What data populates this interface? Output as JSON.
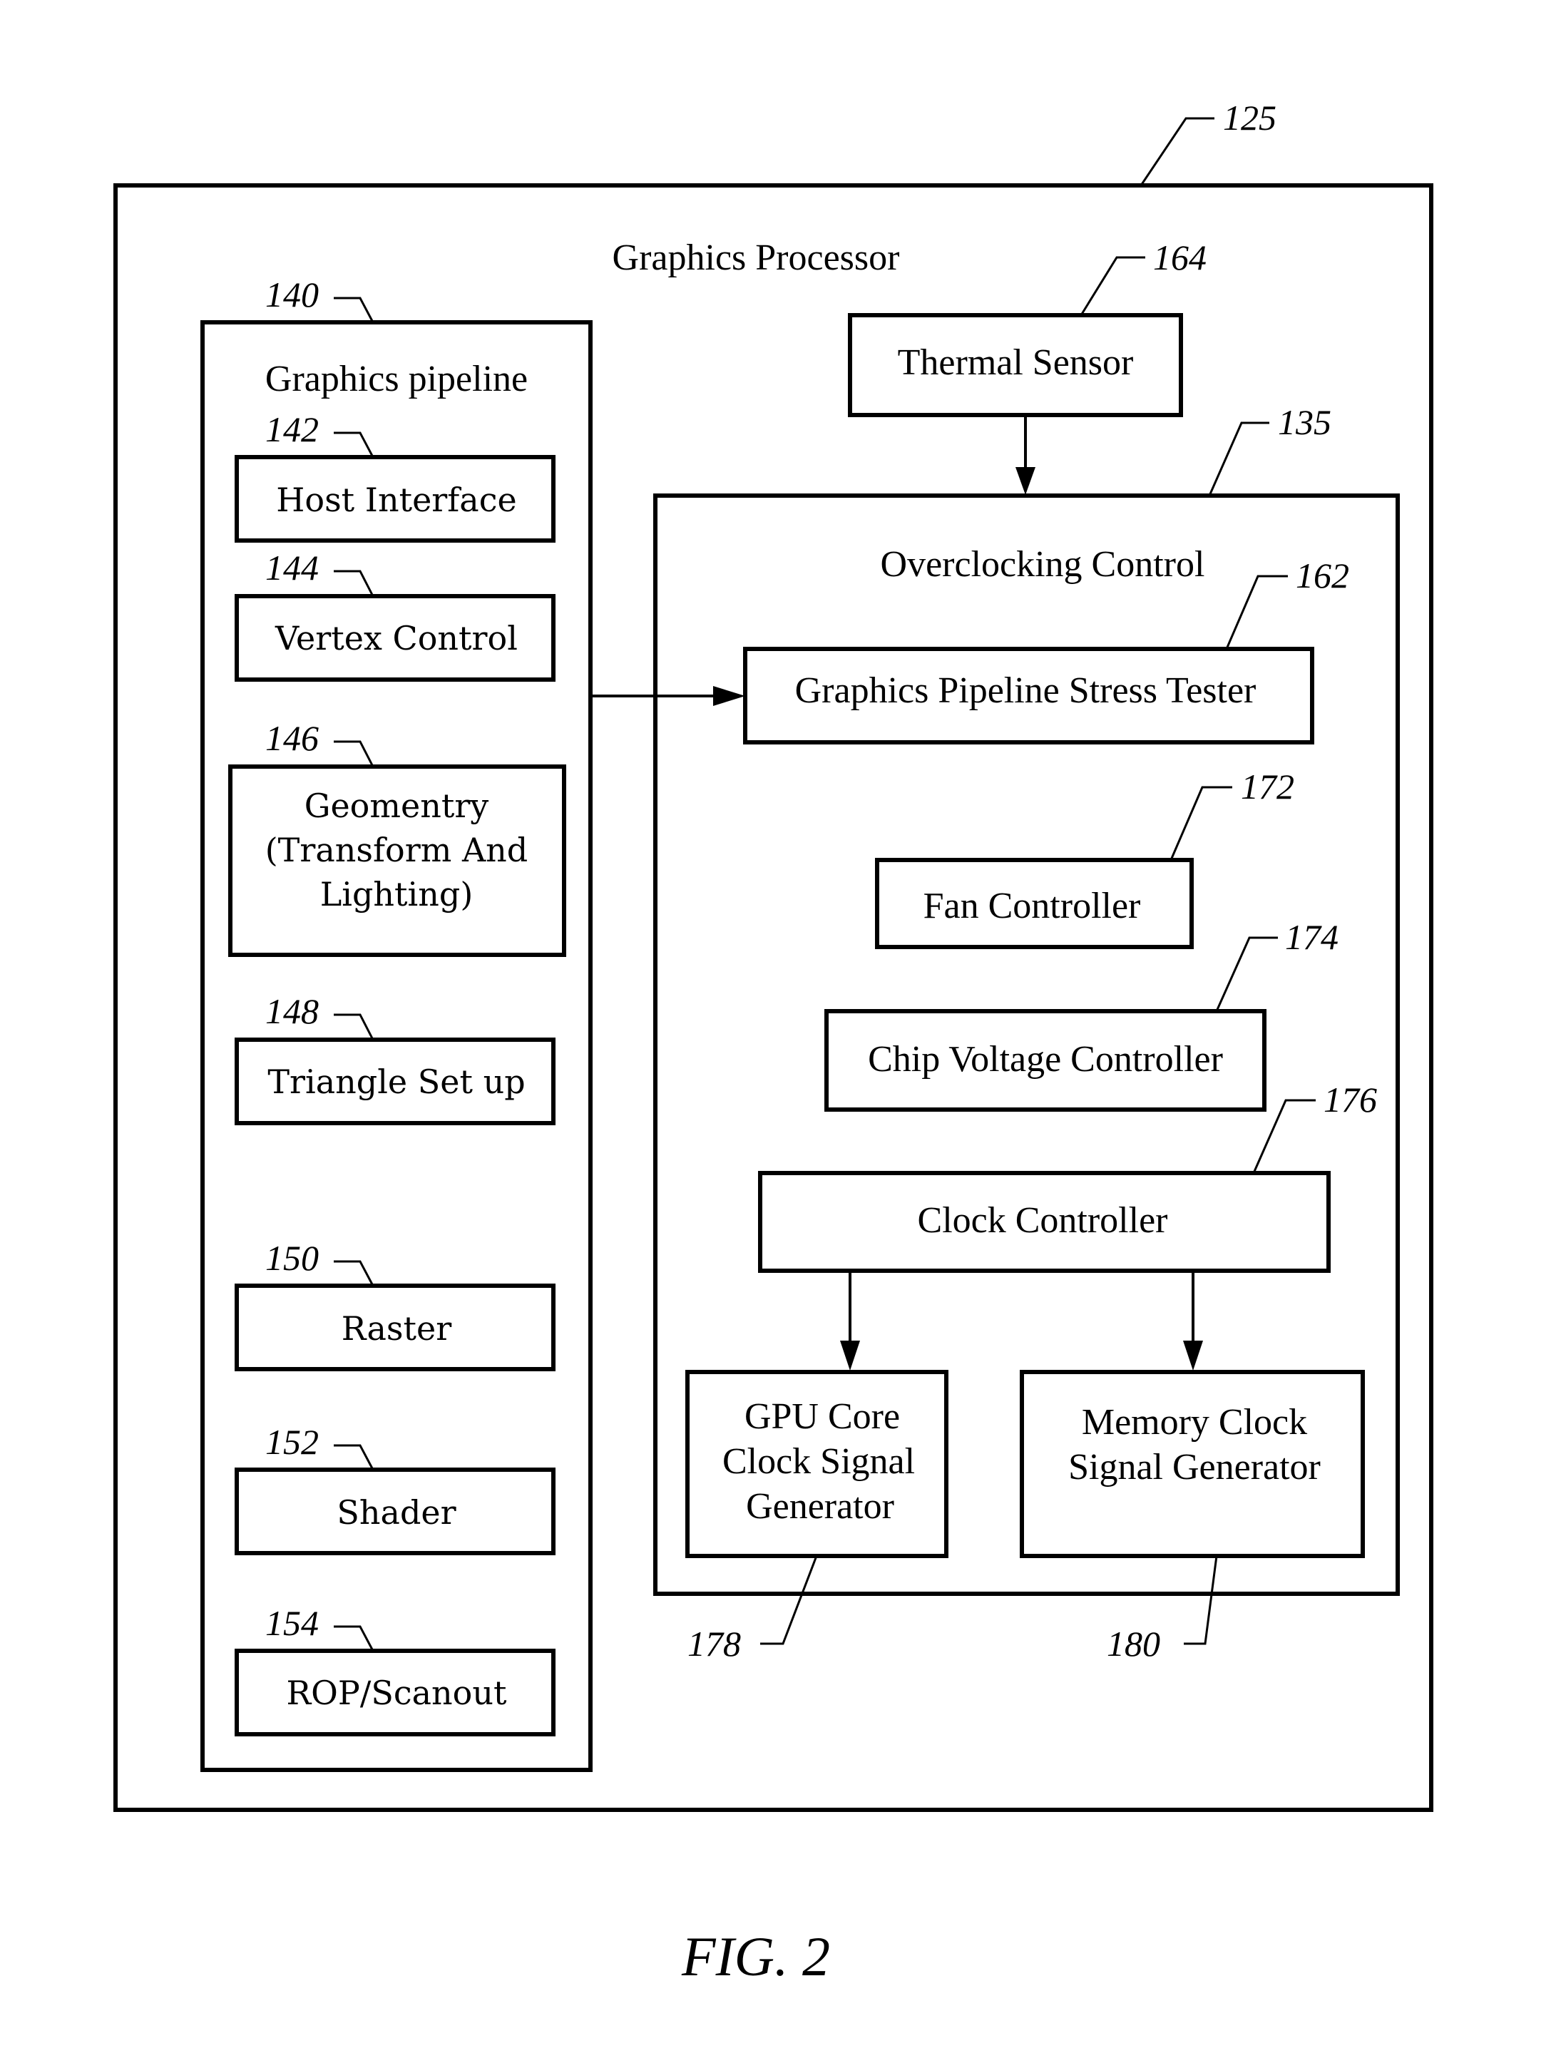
{
  "figure": {
    "caption": "FIG. 2",
    "colors": {
      "stroke": "#000000",
      "background": "#ffffff"
    }
  },
  "graphics_processor": {
    "ref": "125",
    "title": "Graphics Processor"
  },
  "graphics_pipeline": {
    "ref": "140",
    "title": "Graphics pipeline",
    "stages": [
      {
        "ref": "142",
        "lines": [
          "Host Interface"
        ]
      },
      {
        "ref": "144",
        "lines": [
          "Vertex Control"
        ]
      },
      {
        "ref": "146",
        "lines": [
          "Geomentry",
          "(Transform And",
          "Lighting)"
        ]
      },
      {
        "ref": "148",
        "lines": [
          "Triangle Set up"
        ]
      },
      {
        "ref": "150",
        "lines": [
          "Raster"
        ]
      },
      {
        "ref": "152",
        "lines": [
          "Shader"
        ]
      },
      {
        "ref": "154",
        "lines": [
          "ROP/Scanout"
        ]
      }
    ]
  },
  "thermal_sensor": {
    "ref": "164",
    "label": "Thermal Sensor"
  },
  "overclocking_control": {
    "ref": "135",
    "title": "Overclocking Control",
    "stress_tester": {
      "ref": "162",
      "label": "Graphics Pipeline Stress Tester"
    },
    "fan_controller": {
      "ref": "172",
      "label": "Fan Controller"
    },
    "chip_voltage_controller": {
      "ref": "174",
      "label": "Chip Voltage Controller"
    },
    "clock_controller": {
      "ref": "176",
      "label": "Clock Controller"
    },
    "gpu_core_clock": {
      "ref": "178",
      "lines": [
        "GPU Core",
        "Clock Signal",
        "Generator"
      ]
    },
    "memory_clock": {
      "ref": "180",
      "lines": [
        "Memory Clock",
        "Signal Generator"
      ]
    }
  },
  "connections": [
    {
      "from": "thermal_sensor",
      "to": "overclocking_control"
    },
    {
      "from": "graphics_pipeline",
      "to": "stress_tester"
    },
    {
      "from": "clock_controller",
      "to": "gpu_core_clock"
    },
    {
      "from": "clock_controller",
      "to": "memory_clock"
    }
  ]
}
